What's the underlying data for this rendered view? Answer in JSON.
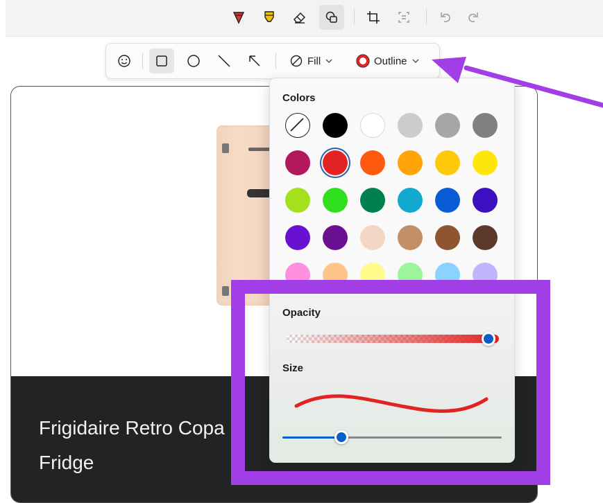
{
  "toolbar": {
    "tools": [
      {
        "name": "pen-tool",
        "icon": "pen-icon",
        "color": "#e03030"
      },
      {
        "name": "highlighter-tool",
        "icon": "highlighter-icon",
        "color": "#f2c200"
      },
      {
        "name": "eraser-tool",
        "icon": "eraser-icon"
      },
      {
        "name": "shapes-tool",
        "icon": "shapes-icon",
        "active": true
      },
      {
        "name": "crop-tool",
        "icon": "crop-icon"
      },
      {
        "name": "text-actions-tool",
        "icon": "text-actions-icon"
      },
      {
        "name": "undo",
        "icon": "undo-icon"
      },
      {
        "name": "redo",
        "icon": "redo-icon"
      }
    ]
  },
  "shape_toolbar": {
    "shapes": [
      {
        "name": "emoji",
        "icon": "emoji-icon"
      },
      {
        "name": "rectangle",
        "icon": "rectangle-icon",
        "active": true
      },
      {
        "name": "circle",
        "icon": "circle-icon"
      },
      {
        "name": "line",
        "icon": "line-icon"
      },
      {
        "name": "arrow",
        "icon": "arrow-icon"
      }
    ],
    "fill_label": "Fill",
    "outline_label": "Outline",
    "outline_color": "#e22323"
  },
  "color_panel": {
    "colors_title": "Colors",
    "swatches": [
      "none",
      "#000000",
      "#ffffff",
      "#cccccc",
      "#a6a6a6",
      "#808080",
      "#b3185c",
      "#e22323",
      "#ff5a10",
      "#ffa50a",
      "#ffc80a",
      "#ffe60a",
      "#a4e01e",
      "#2ee01e",
      "#00804f",
      "#11a9d0",
      "#0a5cd6",
      "#3a10c0",
      "#6a10d0",
      "#6a1090",
      "#f3d6c4",
      "#c19066",
      "#8d5630",
      "#5b3a2b",
      "#ff90e0",
      "#ffc48a",
      "#fffa8a",
      "#9cf59c",
      "#8ad2ff",
      "#c2b5ff"
    ],
    "selected_index": 7,
    "opacity_title": "Opacity",
    "opacity_value": 0.95,
    "size_title": "Size",
    "size_value": 0.27,
    "stroke_color": "#e22323"
  },
  "canvas": {
    "caption": "Frigidaire Retro Co",
    "caption_line2": "Fridge",
    "caption_fragment": "pa"
  },
  "annotation": {
    "highlight_color": "#a23ee6"
  }
}
